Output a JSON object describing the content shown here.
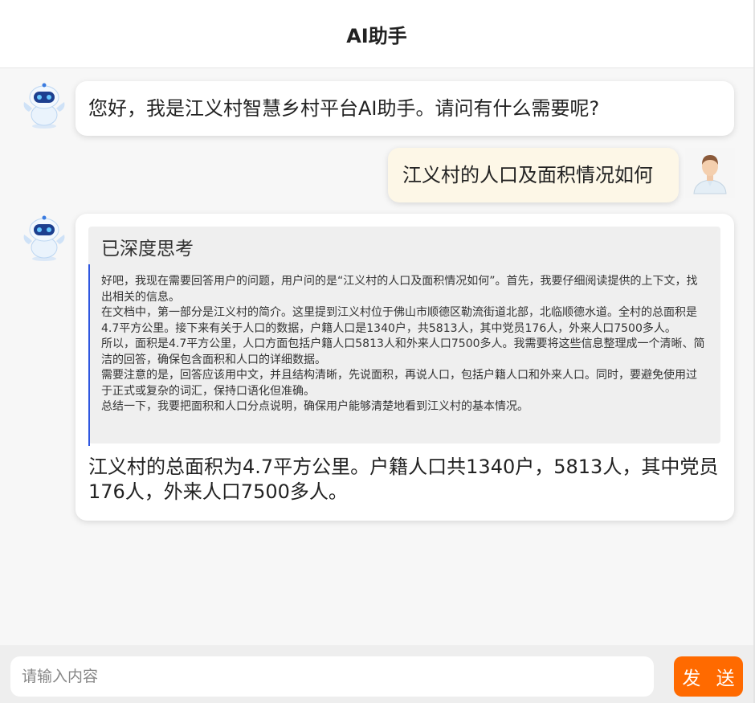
{
  "header": {
    "title": "AI助手"
  },
  "messages": [
    {
      "role": "assistant",
      "text": "您好，我是江义村智慧乡村平台AI助手。请问有什么需要呢?"
    },
    {
      "role": "user",
      "text": "江义村的人口及面积情况如何"
    },
    {
      "role": "assistant",
      "thinking_title": "已深度思考",
      "thinking": [
        "好吧，我现在需要回答用户的问题，用户问的是“江义村的人口及面积情况如何”。首先，我要仔细阅读提供的上下文，找出相关的信息。",
        "在文档中，第一部分是江义村的简介。这里提到江义村位于佛山市顺德区勒流街道北部，北临顺德水道。全村的总面积是4.7平方公里。接下来有关于人口的数据，户籍人口是1340户，共5813人，其中党员176人，外来人口7500多人。",
        "所以，面积是4.7平方公里，人口方面包括户籍人口5813人和外来人口7500多人。我需要将这些信息整理成一个清晰、简洁的回答，确保包含面积和人口的详细数据。",
        "需要注意的是，回答应该用中文，并且结构清晰，先说面积，再说人口，包括户籍人口和外来人口。同时，要避免使用过于正式或复杂的词汇，保持口语化但准确。",
        "总结一下，我要把面积和人口分点说明，确保用户能够清楚地看到江义村的基本情况。"
      ],
      "text": "江义村的总面积为4.7平方公里。户籍人口共1340户，5813人，其中党员176人，外来人口7500多人。"
    }
  ],
  "input": {
    "placeholder": "请输入内容",
    "value": ""
  },
  "send_label": "发 送",
  "colors": {
    "accent": "#ff6a00",
    "user_bubble": "#fdf7e7",
    "think_bar": "#2f57e0"
  },
  "icons": {
    "bot": "robot-avatar-icon",
    "user": "user-avatar-icon"
  }
}
